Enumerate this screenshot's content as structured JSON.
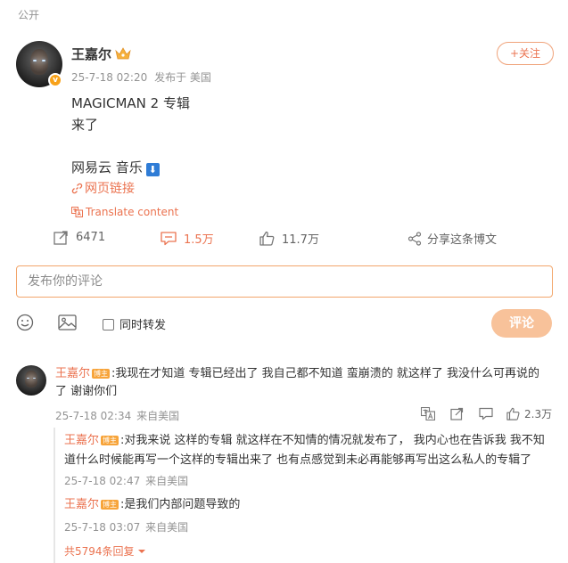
{
  "post": {
    "visibility": "公开",
    "author": "王嘉尔",
    "verified_badge": "v",
    "timestamp": "25-7-18 02:20",
    "source": "发布于 美国",
    "follow_label": "+关注",
    "content_lines": [
      "MAGICMAN 2 专辑",
      "来了",
      "网易云 音乐"
    ],
    "download_icon": "⬇",
    "link_label": "网页链接",
    "translate_label": "Translate content"
  },
  "actions": {
    "repost_count": "6471",
    "comment_count": "1.5万",
    "like_count": "11.7万",
    "share_label": "分享这条博文"
  },
  "composer": {
    "placeholder": "发布你的评论",
    "repost_checkbox_label": "同时转发",
    "submit_label": "评论"
  },
  "comments": [
    {
      "author": "王嘉尔",
      "badge": "博主",
      "text": ":我现在才知道 专辑已经出了 我自己都不知道 蛮崩溃的  就这样了 我没什么可再说的了  谢谢你们",
      "timestamp": "25-7-18 02:34",
      "location": "来自美国",
      "likes": "2.3万",
      "replies": [
        {
          "author": "王嘉尔",
          "badge": "博主",
          "text": ":对我来说 这样的专辑 就这样在不知情的情况就发布了， 我内心也在告诉我 我不知道什么时候能再写一个这样的专辑出来了 也有点感觉到未必再能够再写出这么私人的专辑了",
          "timestamp": "25-7-18 02:47",
          "location": "来自美国"
        },
        {
          "author": "王嘉尔",
          "badge": "博主",
          "text": ":是我们内部问题导致的",
          "timestamp": "25-7-18 03:07",
          "location": "来自美国"
        }
      ],
      "more_replies": "共5794条回复"
    }
  ],
  "colors": {
    "accent": "#eb7350",
    "submit_disabled": "#f8c29a",
    "badge": "#f7a43a"
  }
}
